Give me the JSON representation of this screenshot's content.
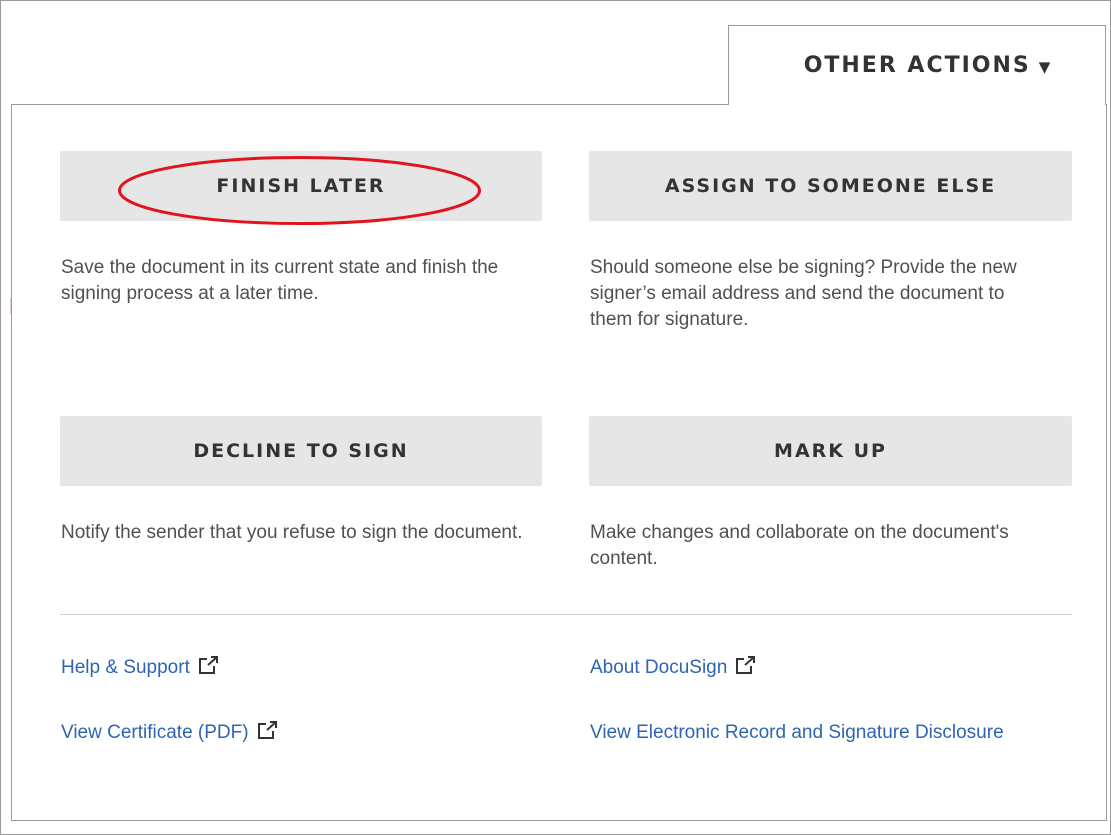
{
  "menu": {
    "title": "OTHER ACTIONS",
    "caret_icon": "caret-down-icon"
  },
  "actions": [
    {
      "label": "FINISH LATER",
      "description": "Save the document in its current state and finish the signing process at a later time."
    },
    {
      "label": "ASSIGN TO SOMEONE ELSE",
      "description": "Should someone else be signing? Provide the new signer’s email address and send the document to them for signature."
    },
    {
      "label": "DECLINE TO SIGN",
      "description": "Notify the sender that you refuse to sign the document."
    },
    {
      "label": "MARK UP",
      "description": "Make changes and collaborate on the document's content."
    }
  ],
  "links": [
    {
      "label": "Help & Support",
      "icon": "external-link-icon"
    },
    {
      "label": "About DocuSign",
      "icon": "external-link-icon"
    },
    {
      "label": "View Certificate (PDF)",
      "icon": "external-link-icon"
    },
    {
      "label": "View Electronic Record and Signature Disclosure"
    }
  ],
  "colors": {
    "link": "#2f64b2",
    "button_bg": "#e6e6e6",
    "highlight": "#e0141e"
  }
}
